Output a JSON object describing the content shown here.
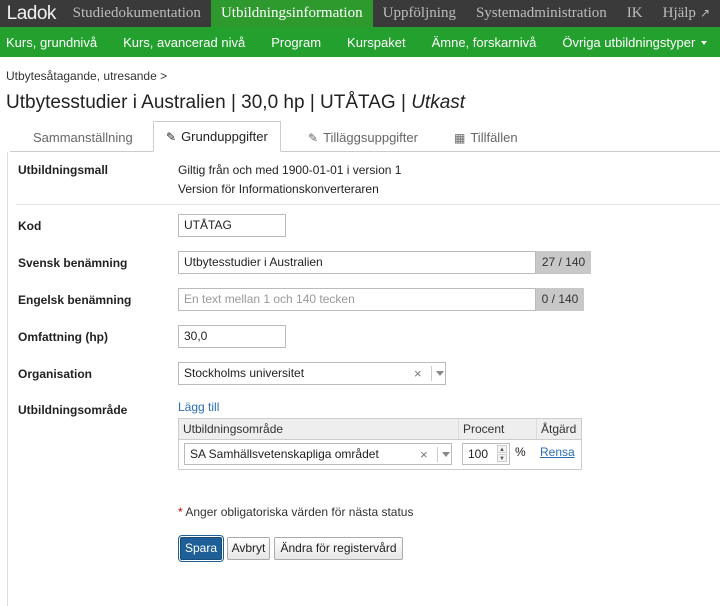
{
  "app": {
    "logo": "Ladok"
  },
  "topnav": {
    "items": [
      "Studiedokumentation",
      "Utbildningsinformation",
      "Uppföljning",
      "Systemadministration",
      "IK",
      "Hjälp"
    ],
    "active": "Utbildningsinformation"
  },
  "subnav": {
    "items": [
      "Kurs, grundnivå",
      "Kurs, avancerad nivå",
      "Program",
      "Kurspaket",
      "Ämne, forskarnivå",
      "Övriga utbildningstyper"
    ]
  },
  "header": {
    "breadcrumb": "Utbytesåtagande, utresande >",
    "title": "Utbytesstudier i Australien | 30,0 hp | UTÅTAG |",
    "status": "Utkast"
  },
  "tabs": [
    {
      "label": "Sammanställning",
      "icon": ""
    },
    {
      "label": "Grunduppgifter",
      "icon": "pencil-icon"
    },
    {
      "label": "Tilläggsuppgifter",
      "icon": "pencil-icon"
    },
    {
      "label": "Tillfällen",
      "icon": "calendar-icon"
    }
  ],
  "active_tab": "Grunduppgifter",
  "form": {
    "utbildningsmall": {
      "label": "Utbildningsmall",
      "line1": "Giltig från och med 1900-01-01 i version 1",
      "line2": "Version för Informationskonverteraren"
    },
    "kod": {
      "label": "Kod",
      "value": "UTÅTAG"
    },
    "svensk": {
      "label": "Svensk benämning",
      "value": "Utbytesstudier i Australien",
      "counter": "27 / 140"
    },
    "engelsk": {
      "label": "Engelsk benämning",
      "value": "",
      "placeholder": "En text mellan 1 och 140 tecken",
      "counter": "0 / 140"
    },
    "omfattning": {
      "label": "Omfattning (hp)",
      "value": "30,0"
    },
    "organisation": {
      "label": "Organisation",
      "value": "Stockholms universitet"
    },
    "utbildningsomrade": {
      "label": "Utbildningsområde",
      "add_link": "Lägg till",
      "columns": [
        "Utbildningsområde",
        "Procent",
        "Åtgärd"
      ],
      "row": {
        "area": "SA Samhällsvetenskapliga området",
        "percent": "100",
        "unit": "%",
        "action": "Rensa"
      }
    }
  },
  "required_note": {
    "star": "*",
    "text": " Anger obligatoriska värden för nästa status"
  },
  "buttons": {
    "save": "Spara",
    "cancel": "Avbryt",
    "change": "Ändra för registervård"
  }
}
